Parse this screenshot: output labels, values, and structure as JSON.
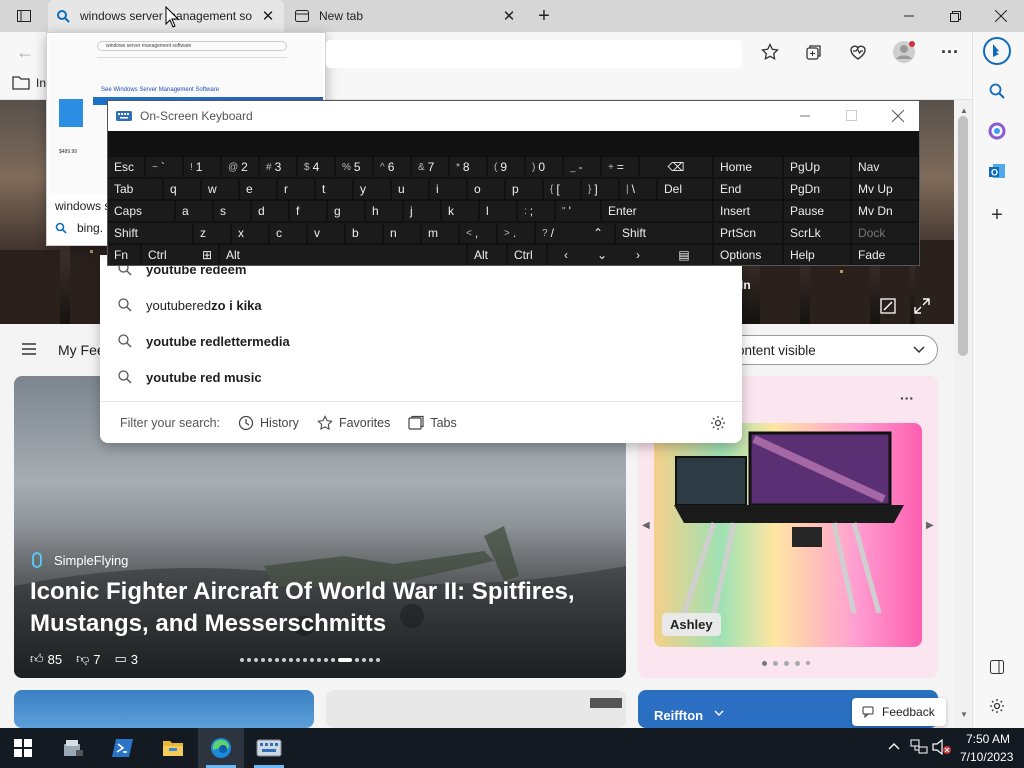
{
  "browser": {
    "tabs": [
      {
        "title": "windows server management so",
        "active": true
      },
      {
        "title": "New tab",
        "active": false
      }
    ],
    "addressbar_text": "bing.",
    "favorites_first": "In"
  },
  "tab_preview": {
    "title": "windows s",
    "url": "bing.",
    "page_heading": "See Windows Server Management Software",
    "search_text": "windows server management software",
    "price": "$489.99"
  },
  "osk": {
    "title": "On-Screen Keyboard",
    "rows": [
      [
        "Esc",
        "~ `",
        "! 1",
        "@ 2",
        "# 3",
        "$ 4",
        "% 5",
        "^ 6",
        "& 7",
        "* 8",
        "( 9",
        ") 0",
        "_ -",
        "+ ="
      ],
      [
        "Tab",
        "q",
        "w",
        "e",
        "r",
        "t",
        "y",
        "u",
        "i",
        "o",
        "p",
        "{ [",
        "} ]",
        "| \\",
        "Del"
      ],
      [
        "Caps",
        "a",
        "s",
        "d",
        "f",
        "g",
        "h",
        "j",
        "k",
        "l",
        ": ;",
        "\" '",
        "Enter"
      ],
      [
        "Shift",
        "z",
        "x",
        "c",
        "v",
        "b",
        "n",
        "m",
        "< ,",
        "> .",
        "? /",
        "Shift"
      ],
      [
        "Fn",
        "Ctrl",
        "Alt",
        "Alt",
        "Ctrl"
      ]
    ],
    "nav_keys": [
      [
        "Home",
        "PgUp",
        "Nav"
      ],
      [
        "End",
        "PgDn",
        "Mv Up"
      ],
      [
        "Insert",
        "Pause",
        "Mv Dn"
      ],
      [
        "PrtScn",
        "ScrLk",
        "Dock"
      ],
      [
        "Options",
        "Help",
        "Fade"
      ]
    ]
  },
  "suggestions": [
    {
      "normal": "",
      "bold": "youtube redeem"
    },
    {
      "normal": "youtubered",
      "bold": "zo i kika"
    },
    {
      "normal": "",
      "bold": "youtube redlettermedia"
    },
    {
      "normal": "",
      "bold": "youtube red music"
    }
  ],
  "suggest_filter": {
    "label": "Filter your search:",
    "history": "History",
    "favorites": "Favorites",
    "tabs": "Tabs"
  },
  "feed": {
    "menu_label": "My Fee",
    "dropdown_label": "ontent visible",
    "hero_text": "In"
  },
  "big_card": {
    "source": "SimpleFlying",
    "headline": "Iconic Fighter Aircraft Of World War II: Spitfires, Mustangs, and Messerschmitts",
    "likes": "85",
    "dislikes": "7",
    "comments": "3"
  },
  "side_card": {
    "tag": "Ashley",
    "more": "···"
  },
  "bottom": {
    "weather_label": "Reiffton",
    "feedback": "Feedback"
  },
  "taskbar": {
    "time": "7:50 AM",
    "date": "7/10/2023"
  },
  "colors": {
    "accent": "#0f6cbd",
    "taskbar": "#141a22",
    "osk_bg": "#111111"
  }
}
